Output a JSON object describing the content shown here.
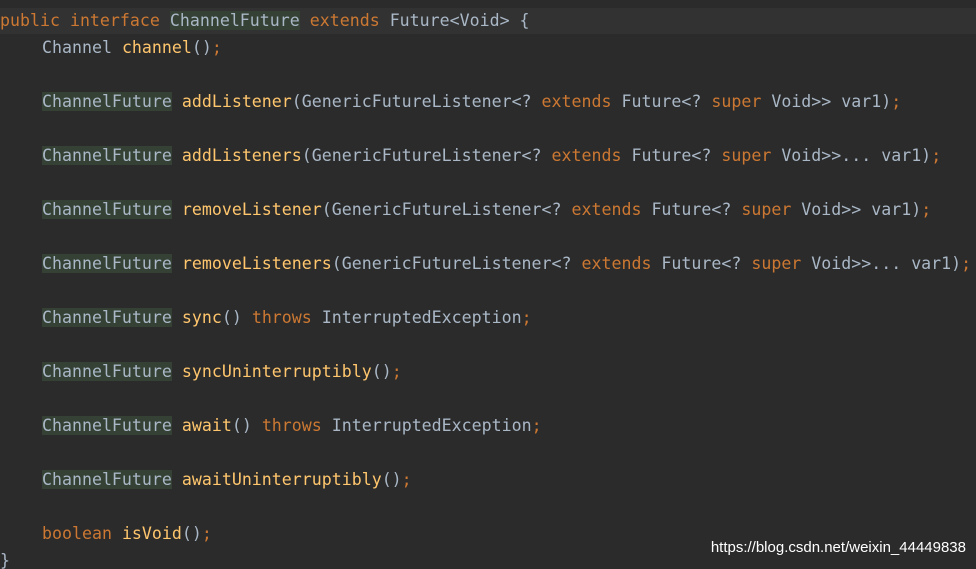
{
  "code": {
    "line1": {
      "public": "public",
      "interface": "interface",
      "name": "ChannelFuture",
      "extends": "extends",
      "rest": "Future<Void> {"
    },
    "line2": {
      "type": "Channel",
      "method": "channel",
      "parens": "()",
      "semi": ";"
    },
    "methods": [
      {
        "ret": "ChannelFuture",
        "name": "addListener",
        "p1": "(GenericFutureListener<? ",
        "k1": "extends",
        "p2": " Future<? ",
        "k2": "super",
        "p3": " Void>> var1)",
        "semi": ";"
      },
      {
        "ret": "ChannelFuture",
        "name": "addListeners",
        "p1": "(GenericFutureListener<? ",
        "k1": "extends",
        "p2": " Future<? ",
        "k2": "super",
        "p3": " Void>>... var1)",
        "semi": ";"
      },
      {
        "ret": "ChannelFuture",
        "name": "removeListener",
        "p1": "(GenericFutureListener<? ",
        "k1": "extends",
        "p2": " Future<? ",
        "k2": "super",
        "p3": " Void>> var1)",
        "semi": ";"
      },
      {
        "ret": "ChannelFuture",
        "name": "removeListeners",
        "p1": "(GenericFutureListener<? ",
        "k1": "extends",
        "p2": " Future<? ",
        "k2": "super",
        "p3": " Void>>... var1)",
        "semi": ";"
      }
    ],
    "sync": {
      "ret": "ChannelFuture",
      "name": "sync",
      "parens": "()",
      "throws": "throws",
      "exception": "InterruptedException",
      "semi": ";"
    },
    "syncUninterruptibly": {
      "ret": "ChannelFuture",
      "name": "syncUninterruptibly",
      "parens": "()",
      "semi": ";"
    },
    "await": {
      "ret": "ChannelFuture",
      "name": "await",
      "parens": "()",
      "throws": "throws",
      "exception": "InterruptedException",
      "semi": ";"
    },
    "awaitUninterruptibly": {
      "ret": "ChannelFuture",
      "name": "awaitUninterruptibly",
      "parens": "()",
      "semi": ";"
    },
    "isVoid": {
      "ret": "boolean",
      "name": "isVoid",
      "parens": "()",
      "semi": ";"
    },
    "closing_brace": "}"
  },
  "watermark": "https://blog.csdn.net/weixin_44449838",
  "colors": {
    "background": "#2b2b2b",
    "keyword": "#cc7832",
    "method": "#ffc66d",
    "text": "#a9b7c6",
    "highlight": "#344134"
  }
}
